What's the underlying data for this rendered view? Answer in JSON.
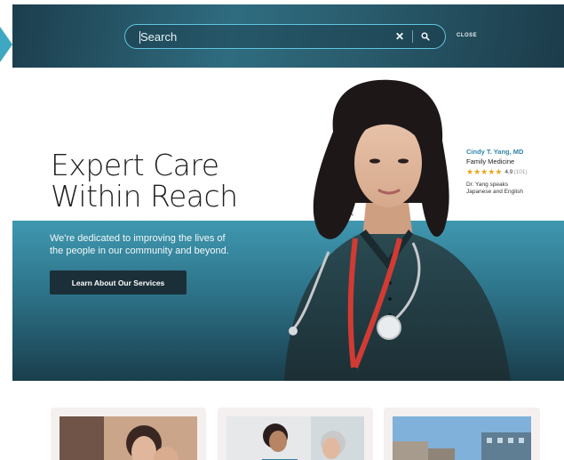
{
  "search": {
    "placeholder": "Search",
    "clear_icon": "close-icon",
    "submit_icon": "search-icon",
    "close_label": "CLOSE"
  },
  "hero": {
    "title_line1": "Expert Care",
    "title_line2": "Within Reach",
    "subtitle_line1": "We're dedicated to improving the lives of",
    "subtitle_line2": "the people in our community and beyond.",
    "cta_label": "Learn About Our Services"
  },
  "doctor": {
    "name": "Cindy T. Yang, MD",
    "specialty": "Family Medicine",
    "rating_value": "4.9",
    "rating_count": "(101)",
    "stars": 5,
    "languages_line1": "Dr. Yang speaks",
    "languages_line2": "Japanese and English"
  },
  "colors": {
    "accent": "#5fc6e0",
    "doctor_name": "#2f86a9",
    "star": "#e6a623",
    "cta_bg": "#1b2f38",
    "band_top": "#3f98b0",
    "band_bottom": "#1a3e4c"
  },
  "cards": [
    {
      "image": "mother-and-child-photo"
    },
    {
      "image": "doctor-with-patient-photo"
    },
    {
      "image": "hospital-building-photo"
    }
  ]
}
